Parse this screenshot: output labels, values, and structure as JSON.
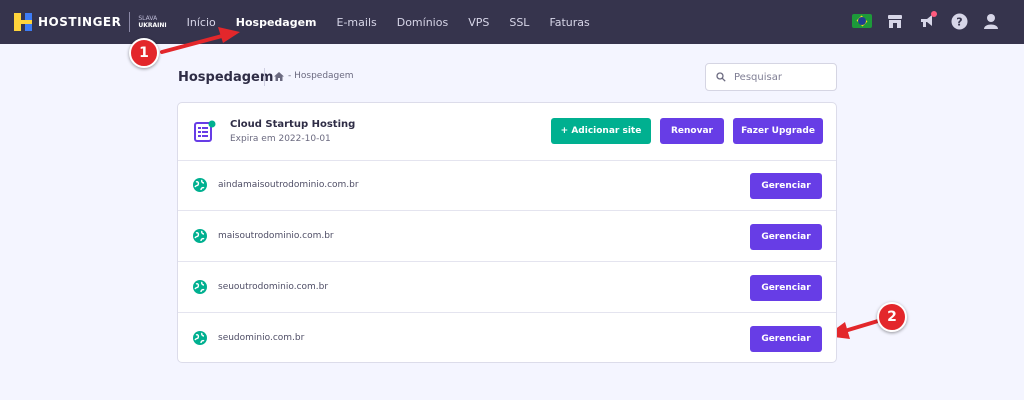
{
  "brand": {
    "name": "HOSTINGER",
    "slava_line1": "SLAVA",
    "slava_line2": "UKRAINI"
  },
  "nav": [
    {
      "label": "Início"
    },
    {
      "label": "Hospedagem"
    },
    {
      "label": "E-mails"
    },
    {
      "label": "Domínios"
    },
    {
      "label": "VPS"
    },
    {
      "label": "SSL"
    },
    {
      "label": "Faturas"
    }
  ],
  "topbar_icons": [
    "brazil-flag-icon",
    "store-icon",
    "megaphone-icon",
    "help-icon",
    "user-icon"
  ],
  "annotations": {
    "badge1": "1",
    "badge2": "2"
  },
  "page": {
    "title": "Hospedagem",
    "breadcrumb": "- Hospedagem",
    "search_placeholder": "Pesquisar"
  },
  "plan": {
    "name": "Cloud Startup Hosting",
    "expires": "Expira em 2022-10-01",
    "add_site_label": "+ Adicionar site",
    "renew_label": "Renovar",
    "upgrade_label": "Fazer Upgrade"
  },
  "sites": [
    {
      "domain": "aindamaisoutrodominio.com.br",
      "button": "Gerenciar"
    },
    {
      "domain": "maisoutrodominio.com.br",
      "button": "Gerenciar"
    },
    {
      "domain": "seuoutrodominio.com.br",
      "button": "Gerenciar"
    },
    {
      "domain": "seudominio.com.br",
      "button": "Gerenciar"
    }
  ],
  "colors": {
    "topbar": "#36344d",
    "primary": "#673de6",
    "success": "#00b090",
    "annotation": "#e3272b",
    "background": "#f4f5ff"
  }
}
